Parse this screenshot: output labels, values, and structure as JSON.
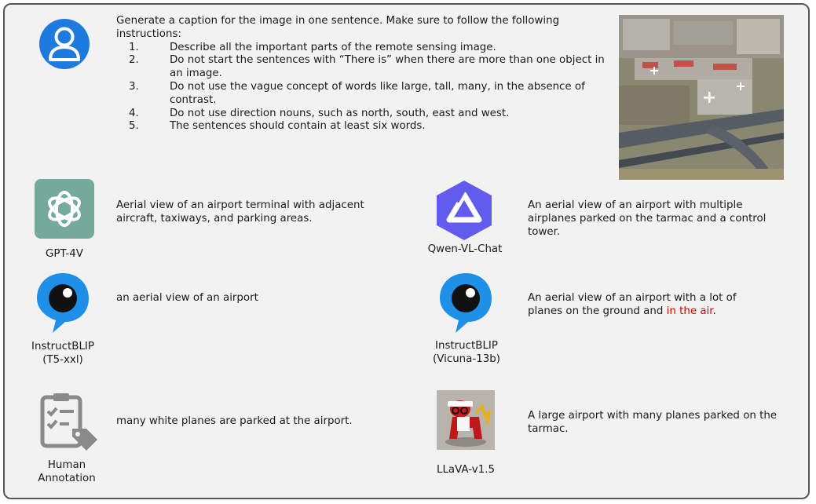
{
  "prompt": {
    "intro": "Generate a caption for the image in one sentence. Make sure to follow the following instructions:",
    "items": [
      {
        "num": "1.",
        "text": "Describe all the important parts of the remote sensing image."
      },
      {
        "num": "2.",
        "text": "Do not start the sentences with “There is” when there are more than one object in an image."
      },
      {
        "num": "3.",
        "text": "Do not use the vague concept of words like large, tall, many, in the absence of contrast."
      },
      {
        "num": "4.",
        "text": "Do not use direction nouns, such as north, south, east and west."
      },
      {
        "num": "5.",
        "text": "The sentences should contain at least six words."
      }
    ]
  },
  "models": {
    "gpt4v": {
      "label": "GPT-4V",
      "caption": "Aerial view of an airport terminal with adjacent aircraft, taxiways, and parking areas."
    },
    "qwen": {
      "label": "Qwen-VL-Chat",
      "caption": "An aerial view of an airport with multiple airplanes parked on the tarmac and a control tower."
    },
    "iblip_t5": {
      "label_line1": "InstructBLIP",
      "label_line2": "(T5-xxl)",
      "caption": "an aerial view of an airport"
    },
    "iblip_vicuna": {
      "label_line1": "InstructBLIP",
      "label_line2": "(Vicuna-13b)",
      "caption_before": "An aerial view of an airport with a lot of planes on the ground and ",
      "caption_highlight": "in the air",
      "caption_after": "."
    },
    "human": {
      "label_line1": "Human",
      "label_line2": "Annotation",
      "caption": "many white planes are parked at the airport."
    },
    "llava": {
      "label": "LLaVA-v1.5",
      "caption": "A large airport with many planes parked on the tarmac."
    }
  },
  "colors": {
    "panel_bg": "#f2f2f2",
    "border": "#555555",
    "user_blue": "#1f7ae0",
    "gpt_green": "#74aa9c",
    "qwen_purple": "#615ced",
    "blip_blue": "#1e90e8",
    "highlight_red": "#e00000"
  }
}
